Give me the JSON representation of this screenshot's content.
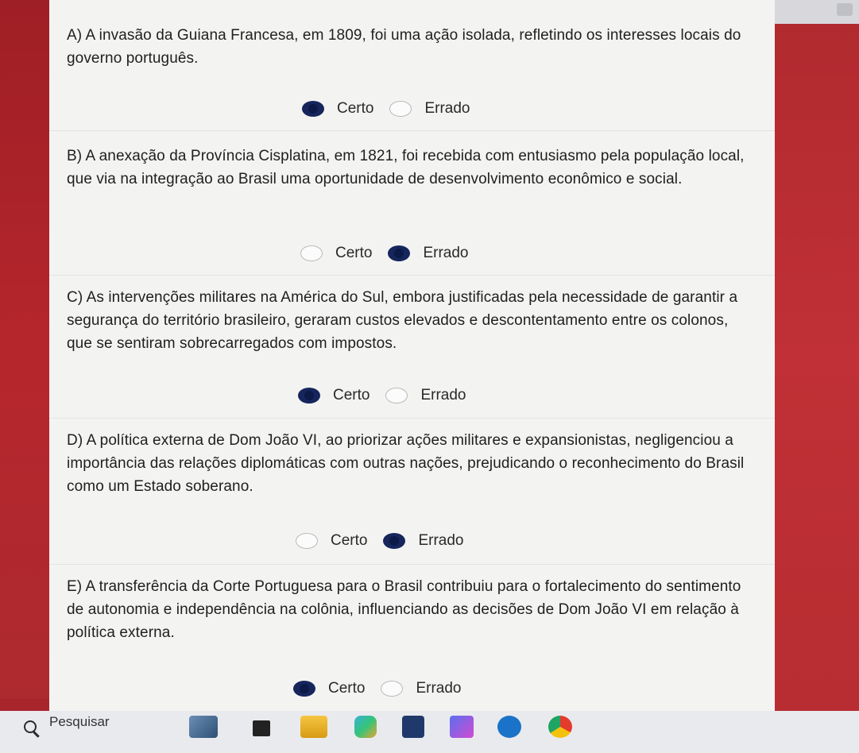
{
  "questions": [
    {
      "text": "A) A invasão da Guiana Francesa, em 1809, foi uma ação isolada, refletindo os interesses locais do governo português.",
      "option_certo": "Certo",
      "option_errado": "Errado",
      "selected": "Certo"
    },
    {
      "text": "B) A anexação da Província Cisplatina, em 1821, foi recebida com entusiasmo pela população local, que via na integração ao Brasil uma oportunidade de desenvolvimento econômico e social.",
      "option_certo": "Certo",
      "option_errado": "Errado",
      "selected": "Errado"
    },
    {
      "text": "C) As intervenções militares na América do Sul, embora justificadas pela necessidade de garantir a segurança do território brasileiro, geraram custos elevados e descontentamento entre os colonos, que se sentiram sobrecarregados com impostos.",
      "option_certo": "Certo",
      "option_errado": "Errado",
      "selected": "Certo"
    },
    {
      "text": "D) A política externa de Dom João VI, ao priorizar ações militares e expansionistas, negligenciou a importância das relações diplomáticas com outras nações, prejudicando o reconhecimento do Brasil como um Estado soberano.",
      "option_certo": "Certo",
      "option_errado": "Errado",
      "selected": "Errado"
    },
    {
      "text": "E) A transferência da Corte Portuguesa para o Brasil contribuiu para o fortalecimento do sentimento de autonomia e independência na colônia, influenciando as decisões de Dom João VI em relação à política externa.",
      "option_certo": "Certo",
      "option_errado": "Errado",
      "selected": "Certo"
    }
  ],
  "taskbar": {
    "search_label": "Pesquisar",
    "pinned_icons": [
      "weather-icon",
      "task-view-icon",
      "file-explorer-icon",
      "copilot-icon",
      "store-icon",
      "office-icon",
      "teams-icon",
      "chrome-icon"
    ]
  },
  "colors": {
    "background_red": "#a8262b",
    "card": "#f3f3f1",
    "radio_checked": "#16265c"
  }
}
